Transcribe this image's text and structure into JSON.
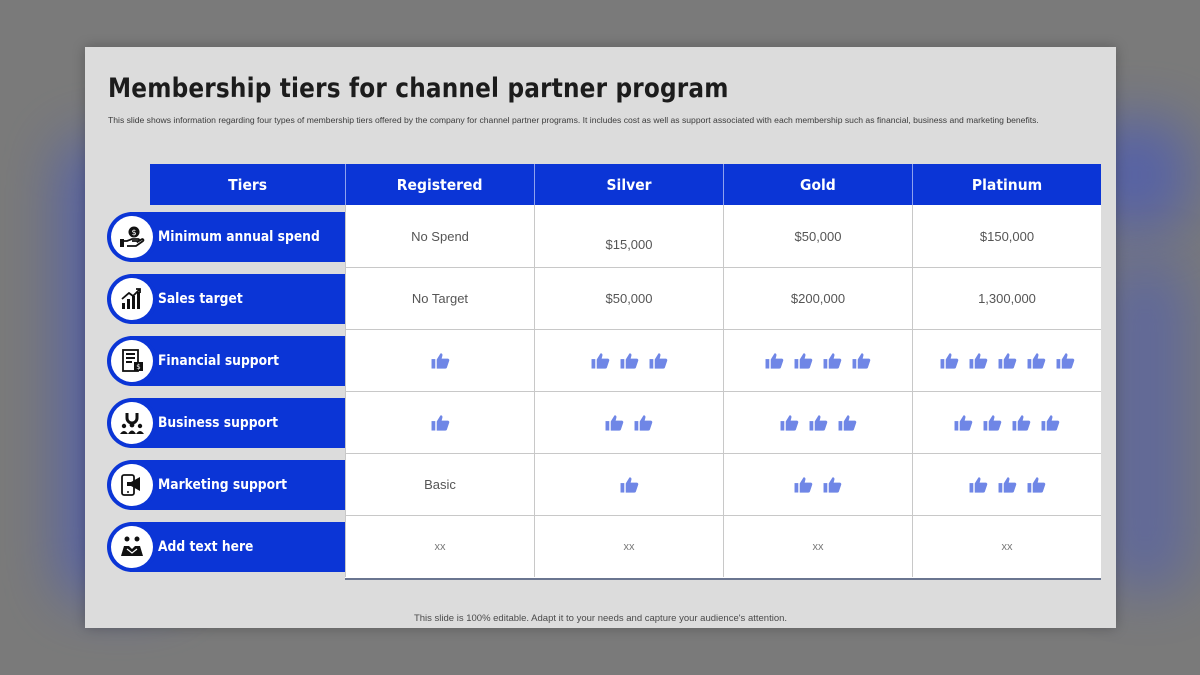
{
  "slide": {
    "title": "Membership tiers for channel partner program",
    "description": "This slide shows information regarding four types of membership tiers offered by the company for channel partner programs. It includes cost as well as support associated with each membership such as financial, business and marketing benefits.",
    "footer": "This slide is 100% editable. Adapt it to your needs and capture your audience's attention."
  },
  "table": {
    "headers": [
      "Tiers",
      "Registered",
      "Silver",
      "Gold",
      "Platinum"
    ],
    "rows": [
      {
        "label": "Minimum annual spend",
        "icon": "money-hand-icon",
        "cells": [
          {
            "text": "No Spend"
          },
          {
            "text": "$15,000"
          },
          {
            "text": "$50,000"
          },
          {
            "text": "$150,000"
          }
        ]
      },
      {
        "label": "Sales target",
        "icon": "growth-chart-icon",
        "cells": [
          {
            "text": "No Target"
          },
          {
            "text": "$50,000"
          },
          {
            "text": "$200,000"
          },
          {
            "text": "1,300,000"
          }
        ]
      },
      {
        "label": "Financial support",
        "icon": "invoice-icon",
        "cells": [
          {
            "thumbs": 1
          },
          {
            "thumbs": 3
          },
          {
            "thumbs": 4
          },
          {
            "thumbs": 5
          }
        ]
      },
      {
        "label": "Business support",
        "icon": "team-magnet-icon",
        "cells": [
          {
            "thumbs": 1
          },
          {
            "thumbs": 2
          },
          {
            "thumbs": 3
          },
          {
            "thumbs": 4
          }
        ]
      },
      {
        "label": "Marketing support",
        "icon": "mobile-megaphone-icon",
        "cells": [
          {
            "text": "Basic"
          },
          {
            "thumbs": 1
          },
          {
            "thumbs": 2
          },
          {
            "thumbs": 3
          }
        ]
      },
      {
        "label": "Add text here",
        "icon": "handshake-icon",
        "cells": [
          {
            "text": "xx"
          },
          {
            "text": "xx"
          },
          {
            "text": "xx"
          },
          {
            "text": "xx"
          }
        ]
      }
    ]
  },
  "colors": {
    "accent": "#0b35d6",
    "thumb": "#6f86e6",
    "slide_bg": "#dcdcdc"
  }
}
